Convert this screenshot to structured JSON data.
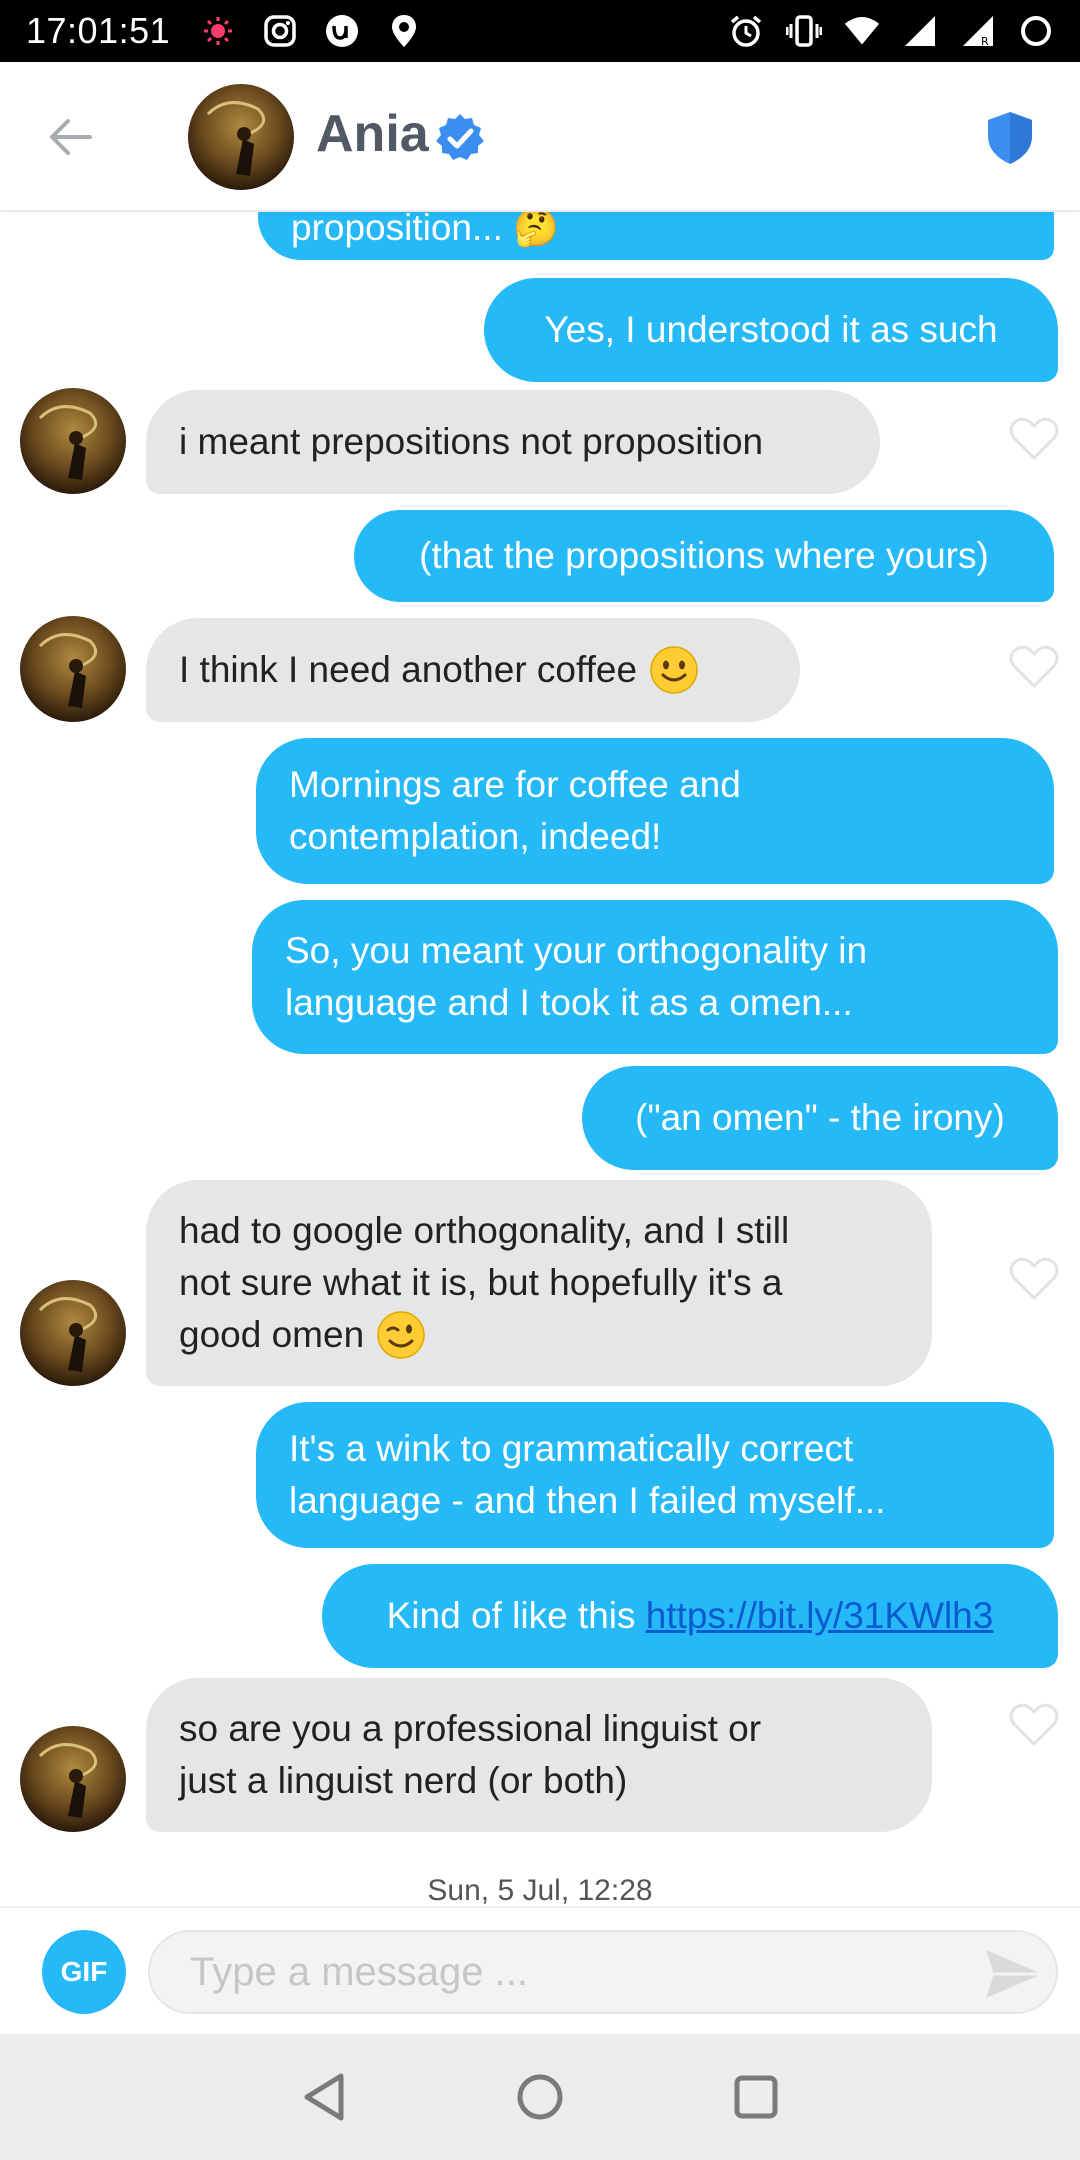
{
  "status_bar": {
    "time": "17:01:51",
    "left_icons": [
      "notification-dot-icon",
      "instagram-icon",
      "app-u-icon",
      "location-icon"
    ],
    "right_icons": [
      "alarm-icon",
      "vibrate-icon",
      "wifi-icon",
      "signal-icon",
      "signal-r-icon",
      "battery-icon"
    ]
  },
  "header": {
    "name": "Ania",
    "verified": true,
    "accent": "#3b8ef0"
  },
  "messages": [
    {
      "side": "sent",
      "text": "proposition... 🤔"
    },
    {
      "side": "sent",
      "text": "Yes, I understood it as such"
    },
    {
      "side": "received",
      "text": "i meant prepositions not proposition"
    },
    {
      "side": "sent",
      "text": "(that the propositions where yours)"
    },
    {
      "side": "received",
      "text": "I think I need another coffee",
      "emoji": "slight-smile"
    },
    {
      "side": "sent",
      "lines": [
        "Mornings are for coffee and",
        "contemplation, indeed!"
      ]
    },
    {
      "side": "sent",
      "lines": [
        "So, you meant your orthogonality in",
        "language and I took it as a omen..."
      ]
    },
    {
      "side": "sent",
      "text": "(\"an omen\" - the irony)"
    },
    {
      "side": "received",
      "lines": [
        "had to google orthogonality, and I still",
        "not sure what it is, but hopefully it's a",
        "good omen"
      ],
      "emoji": "wink"
    },
    {
      "side": "sent",
      "lines": [
        "It's a wink to grammatically correct",
        "language - and then I failed myself..."
      ]
    },
    {
      "side": "sent",
      "text": "Kind of like this",
      "link": "https://bit.ly/31KWlh3"
    },
    {
      "side": "received",
      "lines": [
        "so are you a professional linguist or",
        "just a linguist nerd (or both)"
      ]
    }
  ],
  "date_stamp": "Sun, 5 Jul, 12:28",
  "composer": {
    "gif_label": "GIF",
    "placeholder": "Type a message ..."
  },
  "colors": {
    "sent_bubble": "#25b9f7",
    "received_bubble": "#e6e6e6",
    "link": "#0a5bd0"
  }
}
